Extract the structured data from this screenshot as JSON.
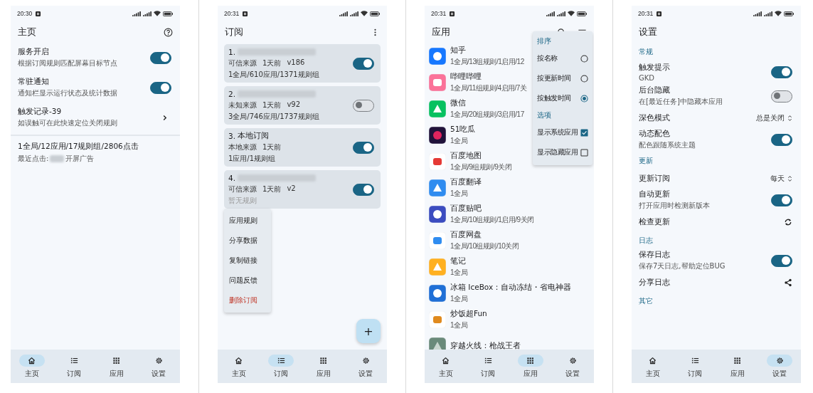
{
  "screens": [
    {
      "kind": "home",
      "time": "20:30",
      "title": "主页",
      "rows": [
        {
          "kind": "switch",
          "title": "服务开启",
          "subtitle": "根据订阅规则匹配屏幕目标节点",
          "on": true
        },
        {
          "kind": "switch",
          "title": "常驻通知",
          "subtitle": "通知栏显示运行状态及统计数据",
          "on": true
        },
        {
          "kind": "link",
          "title": "触发记录-39",
          "subtitle": "如误触可在此快速定位关闭规则"
        }
      ],
      "summary": {
        "stats": "1全局/12应用/17规则组/2806点击",
        "recent_label": "最近点击:",
        "recent_app_redacted": true,
        "recent_rule": "开屏广告"
      },
      "nav": [
        {
          "label": "主页",
          "selected": true
        },
        {
          "label": "订阅",
          "selected": false
        },
        {
          "label": "应用",
          "selected": false
        },
        {
          "label": "设置",
          "selected": false
        }
      ]
    },
    {
      "kind": "subscriptions",
      "time": "20:31",
      "title": "订阅",
      "cards": [
        {
          "index": "1.",
          "name_redacted": true,
          "meta": [
            "可信来源",
            "1天前",
            "v186"
          ],
          "stats": "1全局/610应用/1371规则组",
          "empty": false,
          "on": true
        },
        {
          "index": "2.",
          "name_redacted": true,
          "meta": [
            "未知来源",
            "1天前",
            "v92"
          ],
          "stats": "3全局/746应用/1737规则组",
          "empty": false,
          "on": false
        },
        {
          "index": "3.",
          "name": "本地订阅",
          "name_redacted": false,
          "meta": [
            "本地来源",
            "1天前"
          ],
          "stats": "1应用/1规则组",
          "empty": false,
          "on": true
        },
        {
          "index": "4.",
          "name_redacted": true,
          "meta": [
            "可信来源",
            "1天前",
            "v2"
          ],
          "stats": "暂无规则",
          "empty": true,
          "on": true
        }
      ],
      "menu": [
        {
          "label": "应用规则",
          "kind": "normal"
        },
        {
          "label": "分享数据",
          "kind": "normal"
        },
        {
          "label": "复制链接",
          "kind": "normal"
        },
        {
          "label": "问题反馈",
          "kind": "normal"
        },
        {
          "label": "删除订阅",
          "kind": "danger"
        }
      ],
      "fab": "+",
      "nav": [
        {
          "label": "主页",
          "selected": false
        },
        {
          "label": "订阅",
          "selected": true
        },
        {
          "label": "应用",
          "selected": false
        },
        {
          "label": "设置",
          "selected": false
        }
      ]
    },
    {
      "kind": "apps",
      "time": "20:31",
      "title": "应用",
      "apps": [
        {
          "name": "知乎",
          "summary": "1全局/13组规则/1启用/12"
        },
        {
          "name": "哔哩哔哩",
          "summary": "1全局/11组规则/4启用/7关"
        },
        {
          "name": "微信",
          "summary": "1全局/20组规则/3启用/17"
        },
        {
          "name": "51吃瓜",
          "summary": "1全局"
        },
        {
          "name": "百度地图",
          "summary": "1全局/9组规则/9关闭"
        },
        {
          "name": "百度翻译",
          "summary": "1全局"
        },
        {
          "name": "百度贴吧",
          "summary": "1全局/10组规则/1启用/9关闭"
        },
        {
          "name": "百度网盘",
          "summary": "1全局/10组规则/10关闭"
        },
        {
          "name": "笔记",
          "summary": "1全局"
        },
        {
          "name": "冰箱 IceBox：自动冻结・省电神器",
          "summary": "1全局"
        },
        {
          "name": "炒饭超Fun",
          "summary": "1全局"
        },
        {
          "name": "穿越火线：枪战王者"
        }
      ],
      "menu": [
        {
          "title": "排序",
          "items": [
            {
              "kind": "radio",
              "label": "按名称",
              "selected": false
            },
            {
              "kind": "radio",
              "label": "按更新时间",
              "selected": false
            },
            {
              "kind": "radio",
              "label": "按触发时间",
              "selected": true
            }
          ]
        },
        {
          "title": "选项",
          "items": [
            {
              "kind": "checkbox",
              "label": "显示系统应用",
              "checked": true
            },
            {
              "kind": "checkbox",
              "label": "显示隐藏应用",
              "checked": false
            }
          ]
        }
      ],
      "nav": [
        {
          "label": "主页",
          "selected": false
        },
        {
          "label": "订阅",
          "selected": false
        },
        {
          "label": "应用",
          "selected": true
        },
        {
          "label": "设置",
          "selected": false
        }
      ]
    },
    {
      "kind": "settings",
      "time": "20:31",
      "title": "设置",
      "sections": [
        {
          "title": "常规",
          "rows": [
            {
              "kind": "switch",
              "title": "触发提示",
              "subtitle": "GKD",
              "on": true
            },
            {
              "kind": "switch",
              "title": "后台隐藏",
              "subtitle": "在[最近任务]中隐藏本应用",
              "on": false
            },
            {
              "kind": "select",
              "title": "深色模式",
              "value": "总是关闭"
            },
            {
              "kind": "switch",
              "title": "动态配色",
              "subtitle": "配色跟随系统主题",
              "on": true
            }
          ]
        },
        {
          "title": "更新",
          "rows": [
            {
              "kind": "select",
              "title": "更新订阅",
              "value": "每天"
            },
            {
              "kind": "switch",
              "title": "自动更新",
              "subtitle": "打开应用时检测新版本",
              "on": true
            },
            {
              "kind": "refresh",
              "title": "检查更新"
            }
          ]
        },
        {
          "title": "日志",
          "rows": [
            {
              "kind": "switch",
              "title": "保存日志",
              "subtitle": "保存7天日志,帮助定位BUG",
              "on": true
            },
            {
              "kind": "share",
              "title": "分享日志"
            }
          ]
        },
        {
          "title": "其它"
        }
      ],
      "nav": [
        {
          "label": "主页",
          "selected": false
        },
        {
          "label": "订阅",
          "selected": false
        },
        {
          "label": "应用",
          "selected": false
        },
        {
          "label": "设置",
          "selected": true
        }
      ]
    }
  ]
}
